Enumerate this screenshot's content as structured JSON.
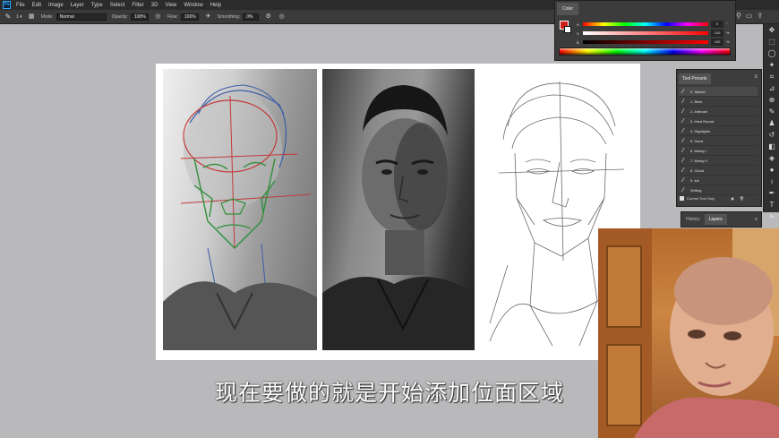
{
  "app": {
    "logo": "Ps",
    "menu": [
      "File",
      "Edit",
      "Image",
      "Layer",
      "Type",
      "Select",
      "Filter",
      "3D",
      "View",
      "Window",
      "Help"
    ]
  },
  "options_bar": {
    "brush_size": "1",
    "mode_label": "Mode:",
    "mode_value": "Normal",
    "opacity_label": "Opacity:",
    "opacity_value": "100%",
    "flow_label": "Flow:",
    "flow_value": "100%",
    "smoothing_label": "Smoothing:",
    "smoothing_value": "0%"
  },
  "color_panel": {
    "tab": "Color",
    "rows": [
      {
        "label": "H",
        "value": "0",
        "unit": "°"
      },
      {
        "label": "S",
        "value": "100",
        "unit": "%"
      },
      {
        "label": "B",
        "value": "100",
        "unit": "%"
      }
    ],
    "fg_color": "#d21d1d",
    "bg_color": "#ffffff"
  },
  "tool_presets": {
    "tab": "Tool Presets",
    "items": [
      "0. Sketch",
      "1. Brick",
      "2. Airbrush",
      "3. Hard Round",
      "4. Highlights",
      "5. Hand",
      "6. Messy I",
      "7. Messy II",
      "8. Cloud",
      "9. Ink",
      "Writing"
    ],
    "active_index": 0,
    "current_tool_only": "Current Tool Only"
  },
  "history_layers": {
    "tabs": [
      "History",
      "Layers"
    ],
    "active": "Layers"
  },
  "subtitle": "现在要做的就是开始添加位面区域",
  "icons": {
    "tool_icon": "brush-icon",
    "toolstrip": [
      "move-icon",
      "marquee-icon",
      "lasso-icon",
      "magic-wand-icon",
      "crop-icon",
      "eyedropper-icon",
      "healing-icon",
      "brush-icon",
      "stamp-icon",
      "history-brush-icon",
      "eraser-icon",
      "bucket-icon",
      "blur-icon",
      "dodge-icon",
      "pen-icon",
      "type-icon",
      "path-select-icon"
    ]
  }
}
